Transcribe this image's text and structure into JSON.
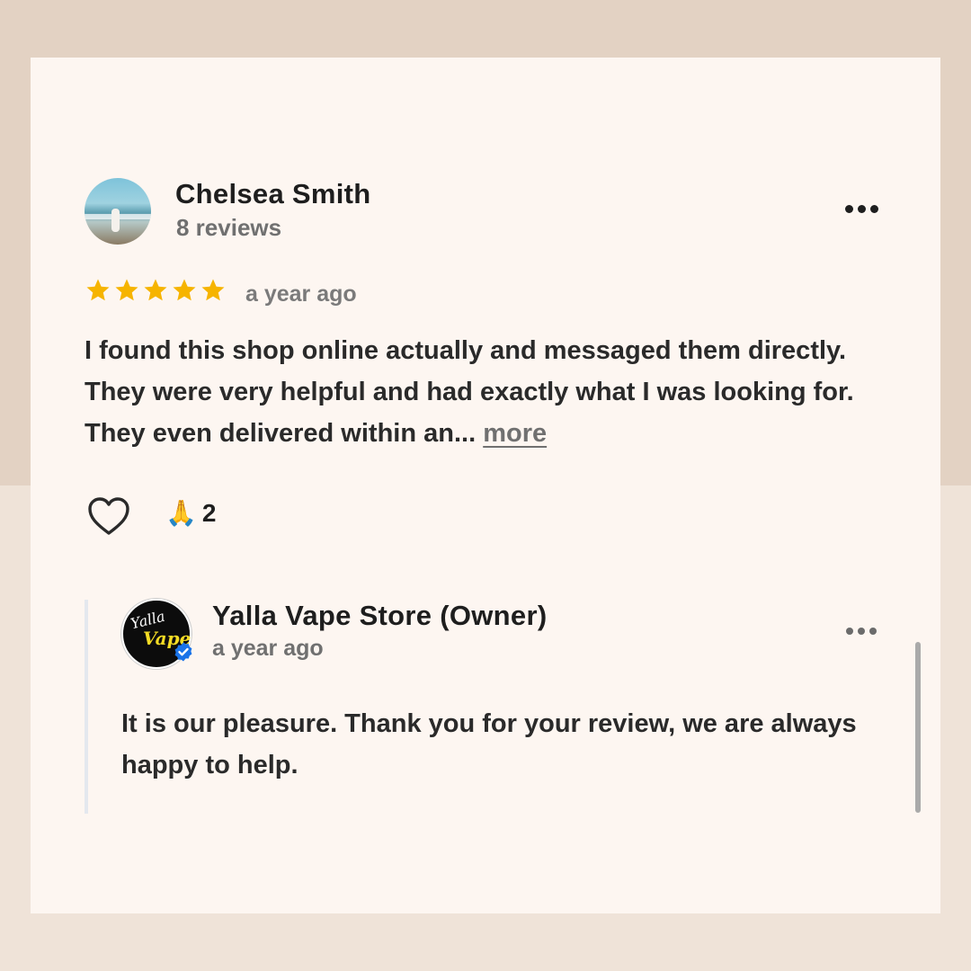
{
  "review": {
    "author_name": "Chelsea Smith",
    "author_reviews": "8 reviews",
    "rating": 5,
    "time_ago": "a year ago",
    "text": "I found this shop online actually and messaged them directly. They were very helpful and had exactly what I was looking for. They even delivered within an...",
    "more_label": "more",
    "reaction_emoji": "🙏",
    "reaction_count": "2"
  },
  "owner_reply": {
    "name": "Yalla Vape Store (Owner)",
    "time_ago": "a year ago",
    "logo_text_top": "Yalla",
    "logo_text_bottom": "Vape",
    "text": "It is our pleasure. Thank you for your review, we are always happy to help."
  },
  "colors": {
    "star": "#f6b400",
    "verified": "#1a73e8",
    "card_bg": "#fdf6f1"
  },
  "icons": {
    "menu": "more-horizontal-icon",
    "like": "heart-outline-icon",
    "verified": "verified-check-icon"
  }
}
